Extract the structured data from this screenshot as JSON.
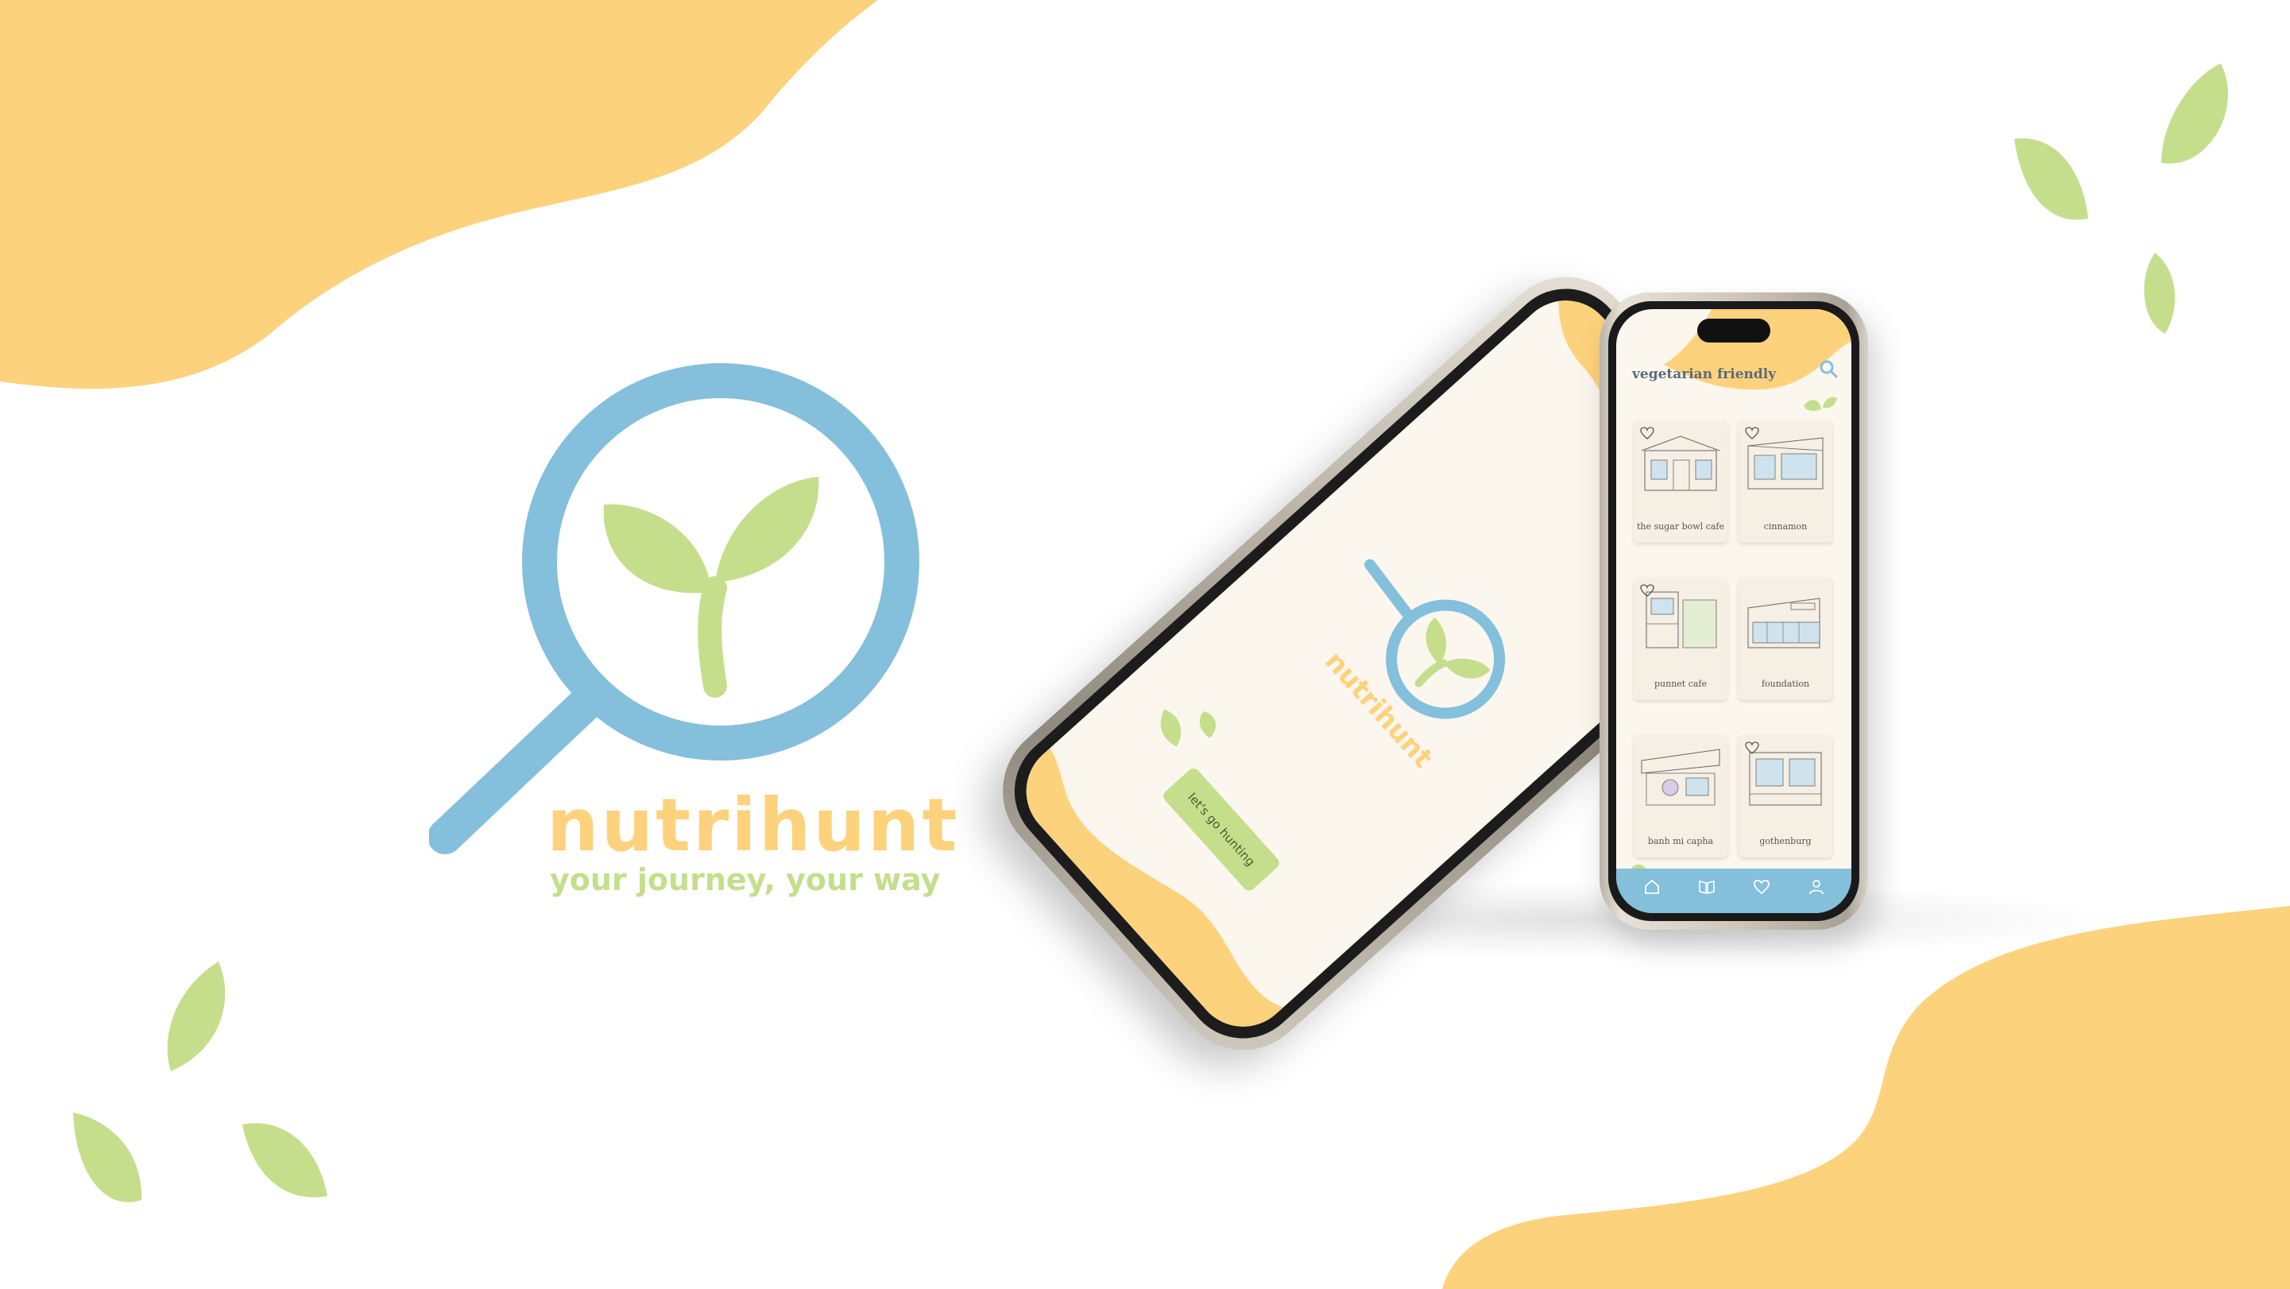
{
  "colors": {
    "yellow": "#FDD27C",
    "blue": "#84BFDC",
    "green": "#C5DE8C",
    "screen_bg": "#FBF6EE"
  },
  "brand": {
    "name": "nutrihunt",
    "tagline": "your journey, your way",
    "mark_icon": "magnifier-sprout-icon"
  },
  "splash_screen": {
    "wordmark": "nutrihunt",
    "start_button": "let's go hunting"
  },
  "list_screen": {
    "title": "vegetarian friendly",
    "search_icon": "search-icon",
    "cafes": [
      {
        "name": "the sugar bowl cafe"
      },
      {
        "name": "cinnamon"
      },
      {
        "name": "punnet cafe"
      },
      {
        "name": "foundation"
      },
      {
        "name": "banh mi capha"
      },
      {
        "name": "gothenburg"
      }
    ],
    "tabs": [
      "home-icon",
      "menu-book-icon",
      "heart-icon",
      "profile-icon"
    ]
  }
}
